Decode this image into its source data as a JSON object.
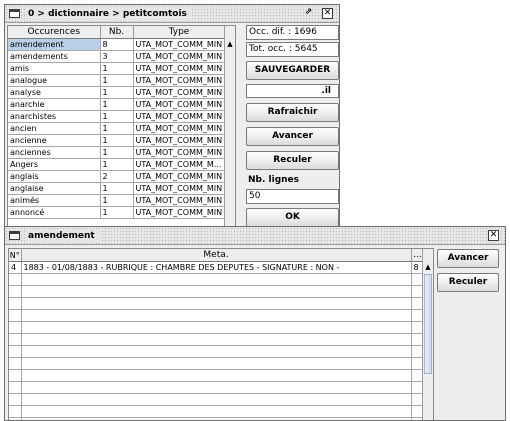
{
  "window1": {
    "title": "0 > dictionnaire > petitcomtois",
    "columns": [
      "Occurences",
      "Nb.",
      "Type"
    ],
    "rows": [
      [
        "amendement",
        "8",
        "UTA_MOT_COMM_MIN"
      ],
      [
        "amendements",
        "3",
        "UTA_MOT_COMM_MIN"
      ],
      [
        "amis",
        "1",
        "UTA_MOT_COMM_MIN"
      ],
      [
        "analogue",
        "1",
        "UTA_MOT_COMM_MIN"
      ],
      [
        "analyse",
        "1",
        "UTA_MOT_COMM_MIN"
      ],
      [
        "anarchie",
        "1",
        "UTA_MOT_COMM_MIN"
      ],
      [
        "anarchistes",
        "1",
        "UTA_MOT_COMM_MIN"
      ],
      [
        "ancien",
        "1",
        "UTA_MOT_COMM_MIN"
      ],
      [
        "ancienne",
        "1",
        "UTA_MOT_COMM_MIN"
      ],
      [
        "anciennes",
        "1",
        "UTA_MOT_COMM_MIN"
      ],
      [
        "Angers",
        "1",
        "UTA_MOT_COMM_M..."
      ],
      [
        "anglais",
        "2",
        "UTA_MOT_COMM_MIN"
      ],
      [
        "anglaise",
        "1",
        "UTA_MOT_COMM_MIN"
      ],
      [
        "animés",
        "1",
        "UTA_MOT_COMM_MIN"
      ],
      [
        "annoncé",
        "1",
        "UTA_MOT_COMM_MIN"
      ]
    ],
    "occ_dif": "Occ. dif. : 1696",
    "tot_occ": "Tot. occ. : 5645",
    "sauvegarder": "SAUVEGARDER",
    "format_field": ".il",
    "rafraichir": "Rafraichir",
    "avancer": "Avancer",
    "reculer": "Reculer",
    "nb_lignes_label": "Nb. lignes",
    "nb_lignes_value": "50",
    "ok": "OK"
  },
  "window2": {
    "title": "amendement",
    "columns": [
      "N°",
      "Meta.",
      "..."
    ],
    "rows": [
      [
        "4",
        "1883 - 01/08/1883 - RUBRIQUE : CHAMBRE DES DEPUTES - SIGNATURE : NON -",
        "8"
      ]
    ],
    "avancer": "Avancer",
    "reculer": "Reculer"
  }
}
